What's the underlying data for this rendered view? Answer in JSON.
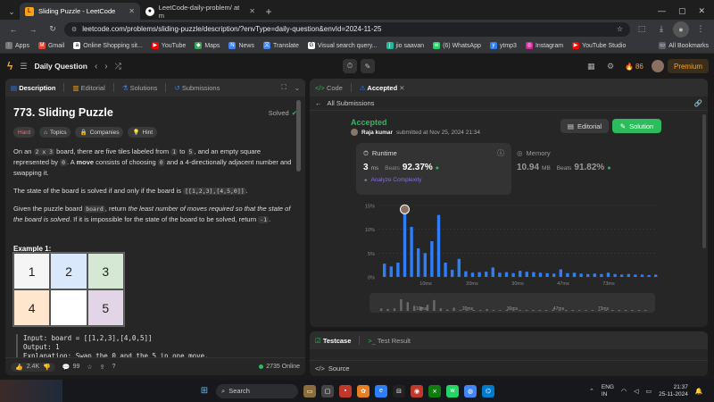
{
  "tabs": [
    {
      "title": "Sliding Puzzle - LeetCode",
      "active": true
    },
    {
      "title": "LeetCode-daily-problem/ at m",
      "active": false
    }
  ],
  "address": "leetcode.com/problems/sliding-puzzle/description/?envType=daily-question&envId=2024-11-25",
  "bookmarks": [
    "Apps",
    "Gmail",
    "Online Shopping sit...",
    "YouTube",
    "Maps",
    "News",
    "Translate",
    "Visual search query...",
    "jio saavan",
    "(6) WhatsApp",
    "ytmp3",
    "Instagram",
    "YouTube Studio"
  ],
  "all_bookmarks": "All Bookmarks",
  "nav": {
    "title": "Daily Question",
    "streak": "86",
    "premium": "Premium"
  },
  "left": {
    "tabs": [
      "Description",
      "Editorial",
      "Solutions",
      "Submissions"
    ],
    "title": "773. Sliding Puzzle",
    "status": "Solved",
    "tags": [
      "Hard",
      "Topics",
      "Companies",
      "Hint"
    ],
    "p1": {
      "t1": "On an ",
      "c1": "2 x 3",
      "t2": " board, there are five tiles labeled from ",
      "c2": "1",
      "t3": " to ",
      "c3": "5",
      "t4": ", and an empty square represented by ",
      "c4": "0",
      "t5": ". A ",
      "b1": "move",
      "t6": " consists of choosing ",
      "c5": "0",
      "t7": " and a 4-directionally adjacent number and swapping it."
    },
    "p2": {
      "t1": "The state of the board is solved if and only if the board is ",
      "c1": "[[1,2,3],[4,5,0]]",
      "t2": "."
    },
    "p3": {
      "t1": "Given the puzzle board ",
      "c1": "board",
      "t2": ", return ",
      "i1": "the least number of moves required so that the state of the board is solved",
      "t3": ". If it is impossible for the state of the board to be solved, return ",
      "c2": "-1",
      "t4": "."
    },
    "example_title": "Example 1:",
    "board": [
      "1",
      "2",
      "3",
      "4",
      "",
      "5"
    ],
    "example_lines": [
      "Input: board = [[1,2,3],[4,0,5]]",
      "Output: 1",
      "Explanation: Swap the 0 and the 5 in one move."
    ],
    "likes": "2.4K",
    "comments": "99",
    "online": "2735 Online"
  },
  "right": {
    "tabs": [
      "Code",
      "Accepted"
    ],
    "back": "All Submissions",
    "verdict": "Accepted",
    "author": "Raja kumar",
    "submitted": "submitted at Nov 25, 2024 21:34",
    "editorial_btn": "Editorial",
    "solution_btn": "Solution",
    "runtime": {
      "label": "Runtime",
      "value": "3",
      "unit": "ms",
      "beats_label": "Beats",
      "beats": "92.37%",
      "analyze": "Analyze Complexity"
    },
    "memory": {
      "label": "Memory",
      "value": "10.94",
      "unit": "MB",
      "beats_label": "Beats",
      "beats": "91.82%"
    }
  },
  "bottom": {
    "tabs": [
      "Testcase",
      "Test Result"
    ],
    "source": "Source"
  },
  "taskbar": {
    "search": "Search",
    "lang1": "ENG",
    "lang2": "IN",
    "time": "21:37",
    "date": "25-11-2024"
  },
  "chart_data": {
    "type": "bar",
    "title": "",
    "xlabel": "Runtime (ms)",
    "ylabel": "",
    "x_tick_labels": [
      "10ms",
      "20ms",
      "30ms",
      "47ms",
      "73ms"
    ],
    "y_tick_labels": [
      "15%",
      "10%",
      "5%",
      "0%"
    ],
    "ylim": [
      0,
      15
    ],
    "values": [
      2.8,
      2.2,
      3.0,
      14,
      10.5,
      6,
      5,
      7.5,
      13,
      3,
      1.5,
      3.8,
      1.2,
      0.9,
      1.0,
      1.1,
      2.0,
      0.9,
      1.0,
      0.8,
      1.3,
      1.1,
      1.0,
      0.9,
      0.8,
      0.7,
      1.6,
      0.8,
      0.9,
      0.7,
      0.6,
      0.7,
      0.6,
      0.9,
      0.6,
      0.5,
      0.6,
      0.5,
      0.5,
      0.4,
      0.5
    ],
    "highlight_index": 3,
    "grid": true
  }
}
